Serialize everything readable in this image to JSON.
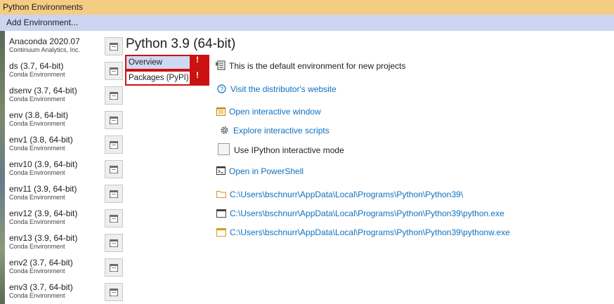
{
  "window": {
    "title": "Python Environments"
  },
  "toolbar": {
    "add_label": "Add Environment..."
  },
  "environments": [
    {
      "name": "Anaconda 2020.07",
      "desc": "Continuum Analytics, Inc."
    },
    {
      "name": "ds (3.7, 64-bit)",
      "desc": "Conda Environment"
    },
    {
      "name": "dsenv (3.7, 64-bit)",
      "desc": "Conda Environment"
    },
    {
      "name": "env (3.8, 64-bit)",
      "desc": "Conda Environment"
    },
    {
      "name": "env1 (3.8, 64-bit)",
      "desc": "Conda Environment"
    },
    {
      "name": "env10 (3.9, 64-bit)",
      "desc": "Conda Environment"
    },
    {
      "name": "env11 (3.9, 64-bit)",
      "desc": "Conda Environment"
    },
    {
      "name": "env12 (3.9, 64-bit)",
      "desc": "Conda Environment"
    },
    {
      "name": "env13 (3.9, 64-bit)",
      "desc": "Conda Environment"
    },
    {
      "name": "env2 (3.7, 64-bit)",
      "desc": "Conda Environment"
    },
    {
      "name": "env3 (3.7, 64-bit)",
      "desc": "Conda Environment"
    }
  ],
  "detail": {
    "title": "Python 3.9 (64-bit)",
    "tabs": [
      {
        "label": "Overview",
        "error": "!"
      },
      {
        "label": "Packages (PyPI)",
        "error": "!"
      }
    ],
    "default_text": "This is the default environment for new projects",
    "visit_link": "Visit the distributor's website",
    "open_interactive": "Open interactive window",
    "explore_scripts": "Explore interactive scripts",
    "ipython_label": "Use IPython interactive mode",
    "ipython_checked": false,
    "open_powershell": "Open in PowerShell",
    "path_folder": "C:\\Users\\bschnurr\\AppData\\Local\\Programs\\Python\\Python39\\",
    "path_python": "C:\\Users\\bschnurr\\AppData\\Local\\Programs\\Python\\Python39\\python.exe",
    "path_pythonw": "C:\\Users\\bschnurr\\AppData\\Local\\Programs\\Python\\Python39\\pythonw.exe"
  },
  "colors": {
    "title_bar": "#f5cc84",
    "add_bar": "#ccd5f0",
    "link": "#0e70c0",
    "tab_error": "#cc1111",
    "tab_selected": "#cfd8f2"
  }
}
